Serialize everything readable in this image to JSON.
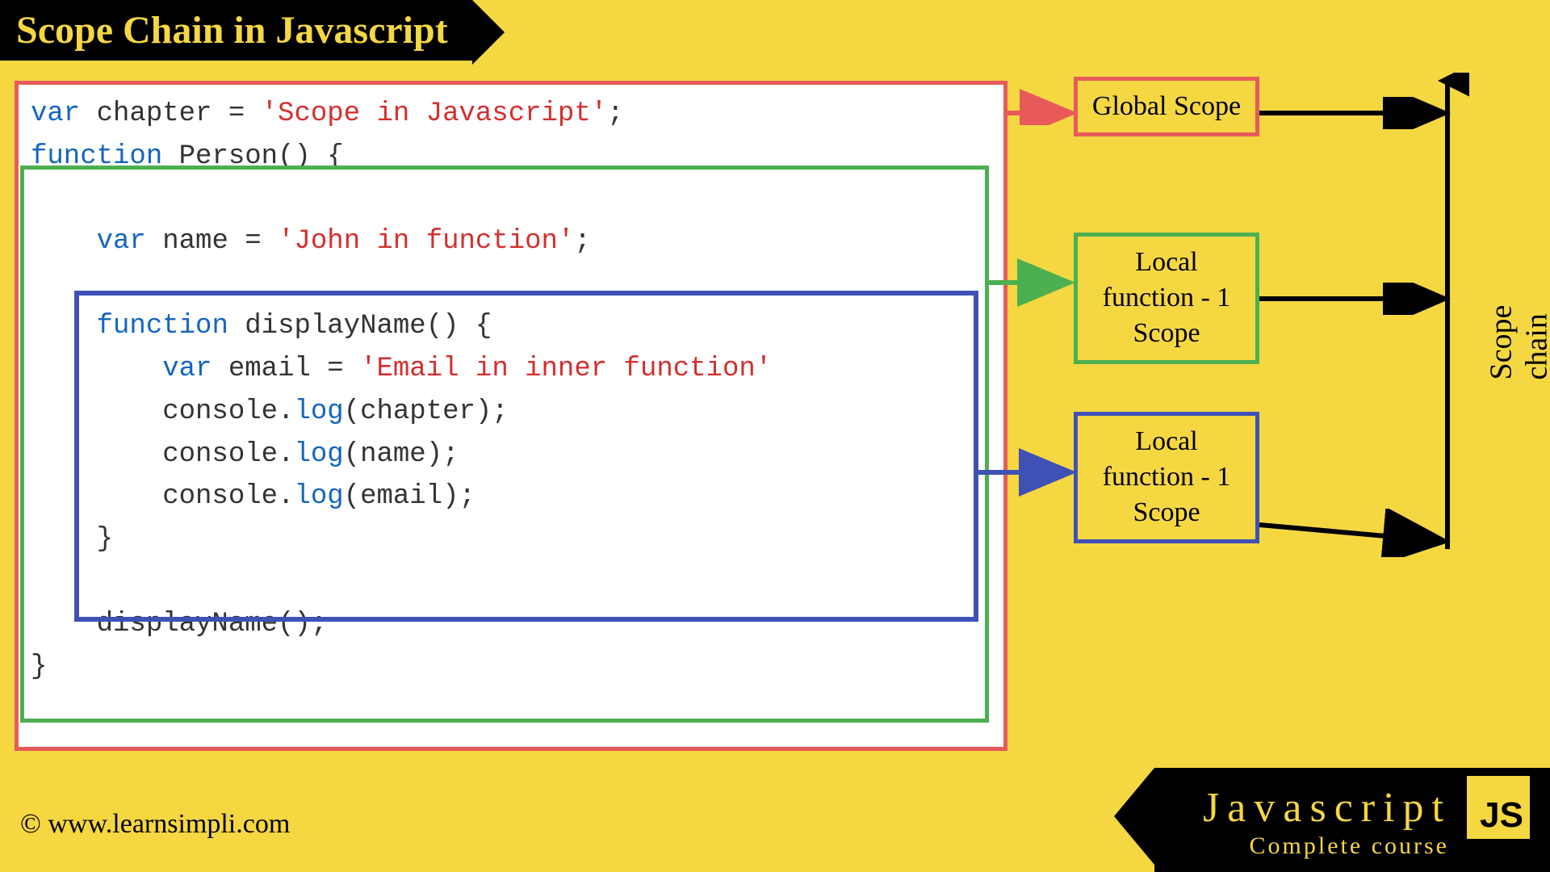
{
  "title": "Scope Chain in Javascript",
  "code": {
    "line1_var": "var",
    "line1_ident": " chapter = ",
    "line1_str": "'Scope in Javascript'",
    "line1_end": ";",
    "line2_func": "function",
    "line2_name": " Person() {",
    "line4_indent": "    ",
    "line4_var": "var",
    "line4_ident": " name = ",
    "line4_str": "'John in function'",
    "line4_end": ";",
    "line6_indent": "    ",
    "line6_func": "function",
    "line6_name": " displayName() {",
    "line7_indent": "        ",
    "line7_var": "var",
    "line7_ident": " email = ",
    "line7_str": "'Email in inner function'",
    "line8_indent": "        console.",
    "line8_log": "log",
    "line8_arg": "(chapter);",
    "line9_indent": "        console.",
    "line9_log": "log",
    "line9_arg": "(name);",
    "line10_indent": "        console.",
    "line10_log": "log",
    "line10_arg": "(email);",
    "line11": "    }",
    "line13": "    displayName();",
    "line14": "}"
  },
  "scopes": {
    "global": "Global Scope",
    "local1": "Local function - 1 Scope",
    "local2": "Local function - 1 Scope"
  },
  "scope_chain_label": "Scope chain",
  "copyright": "© www.learnsimpli.com",
  "footer": {
    "title": "Javascript",
    "subtitle": "Complete course",
    "badge": "JS"
  },
  "colors": {
    "red": "#e85a5a",
    "green": "#4caf50",
    "blue": "#3f51b5",
    "black": "#000000"
  }
}
